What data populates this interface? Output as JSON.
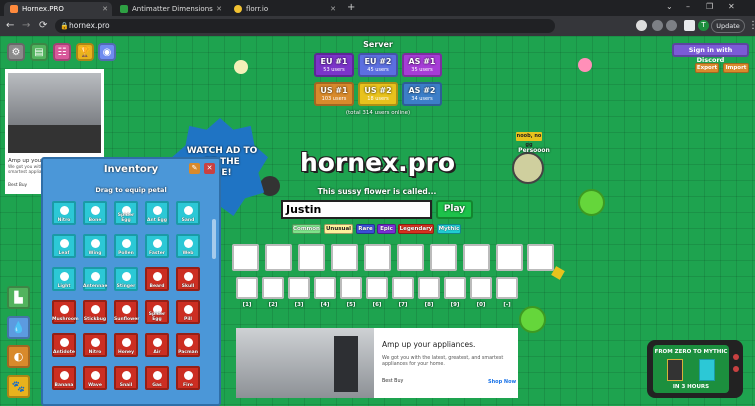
{
  "browser": {
    "tabs": [
      {
        "title": "Hornex.PRO",
        "active": true,
        "favicon_color": "#ff8a3d"
      },
      {
        "title": "Antimatter Dimensions",
        "active": false,
        "favicon_color": "#2ea043"
      },
      {
        "title": "florr.io",
        "active": false,
        "favicon_color": "#f1c232"
      }
    ],
    "new_tab_label": "+",
    "window_controls": {
      "minimize": "–",
      "maximize": "❐",
      "close": "✕",
      "tab_menu": "⌄"
    },
    "nav": {
      "back": "←",
      "forward": "→",
      "reload": "⟳"
    },
    "url": "hornex.pro",
    "profile_initial": "T",
    "update_label": "Update",
    "menu_icon": "⋮"
  },
  "game": {
    "server": {
      "title": "Server",
      "regions": [
        {
          "name": "EU #1",
          "users": "53 users",
          "color": "#7b34c9"
        },
        {
          "name": "EU #2",
          "users": "45 users",
          "color": "#7b34c9"
        },
        {
          "name": "AS #1",
          "users": "35 users",
          "color": "#7b34c9"
        },
        {
          "name": "US #1",
          "users": "103 users",
          "color": "#d88a2c"
        },
        {
          "name": "US #2",
          "users": "18 users",
          "color": "#e8c21d"
        },
        {
          "name": "AS #2",
          "users": "34 users",
          "color": "#2f6ea7"
        }
      ],
      "total": "(total 314 users online)"
    },
    "discord_label": "Sign in with Discord",
    "export_label": "Export",
    "import_label": "Import",
    "watch_ad_text": "WATCH AD TO\nRT THE\nME!",
    "logo": "hornex.pro",
    "subtitle": "This sussy flower is called...",
    "name_value": "Justin",
    "play_label": "Play",
    "rarities": [
      {
        "label": "Common",
        "class": "common"
      },
      {
        "label": "Unusual",
        "class": "unusual"
      },
      {
        "label": "Rare",
        "class": "rare"
      },
      {
        "label": "Epic",
        "class": "epic"
      },
      {
        "label": "Legendary",
        "class": "legendary"
      },
      {
        "label": "Mythic",
        "class": "mythic"
      }
    ],
    "slot_keys": [
      "[1]",
      "[2]",
      "[3]",
      "[4]",
      "[5]",
      "[6]",
      "[7]",
      "[8]",
      "[9]",
      "[0]",
      "[-]"
    ],
    "player_name": "Persooon",
    "player_tag": "noob, no gg",
    "inventory": {
      "title": "Inventory",
      "subtitle": "Drag to equip petal",
      "edit_icon": "✎",
      "close_icon": "✕",
      "petals": [
        {
          "name": "Nitro",
          "rarity": "mythic"
        },
        {
          "name": "Bone",
          "rarity": "mythic"
        },
        {
          "name": "Spider Egg",
          "rarity": "mythic"
        },
        {
          "name": "Ant Egg",
          "rarity": "mythic"
        },
        {
          "name": "Sand",
          "rarity": "mythic"
        },
        {
          "name": "Leaf",
          "rarity": "mythic"
        },
        {
          "name": "Wing",
          "rarity": "mythic"
        },
        {
          "name": "Pollen",
          "rarity": "mythic"
        },
        {
          "name": "Faster",
          "rarity": "mythic"
        },
        {
          "name": "Web",
          "rarity": "mythic"
        },
        {
          "name": "Light",
          "rarity": "mythic"
        },
        {
          "name": "Antennae",
          "rarity": "mythic"
        },
        {
          "name": "Stinger",
          "rarity": "mythic"
        },
        {
          "name": "Beard",
          "rarity": "legendary"
        },
        {
          "name": "Skull",
          "rarity": "legendary"
        },
        {
          "name": "Mushroom",
          "rarity": "legendary"
        },
        {
          "name": "Stickbug",
          "rarity": "legendary"
        },
        {
          "name": "Sunflower",
          "rarity": "legendary"
        },
        {
          "name": "Spider Egg",
          "rarity": "legendary"
        },
        {
          "name": "Pill",
          "rarity": "legendary"
        },
        {
          "name": "Antidote",
          "rarity": "legendary"
        },
        {
          "name": "Nitro",
          "rarity": "legendary"
        },
        {
          "name": "Honey",
          "rarity": "legendary"
        },
        {
          "name": "Air",
          "rarity": "legendary"
        },
        {
          "name": "Pacman",
          "rarity": "legendary"
        },
        {
          "name": "Banana",
          "rarity": "legendary"
        },
        {
          "name": "Wave",
          "rarity": "legendary"
        },
        {
          "name": "Snail",
          "rarity": "legendary"
        },
        {
          "name": "Gas",
          "rarity": "legendary"
        },
        {
          "name": "Fire",
          "rarity": "legendary"
        }
      ]
    },
    "ad_left": {
      "headline": "Amp up your appliances.",
      "body": "We got you with the latest, greatest, and smartest appliances for your home.",
      "brand": "Best Buy",
      "cta": "SHOP NOW"
    },
    "ad_bottom": {
      "headline": "Amp up your appliances.",
      "body": "We got you with the latest, greatest, and smartest appliances for your home.",
      "brand": "Best Buy",
      "cta": "Shop Now"
    },
    "tv": {
      "top_text": "FROM ZERO TO MYTHIC",
      "bottom_text": "IN 3 HOURS"
    }
  }
}
